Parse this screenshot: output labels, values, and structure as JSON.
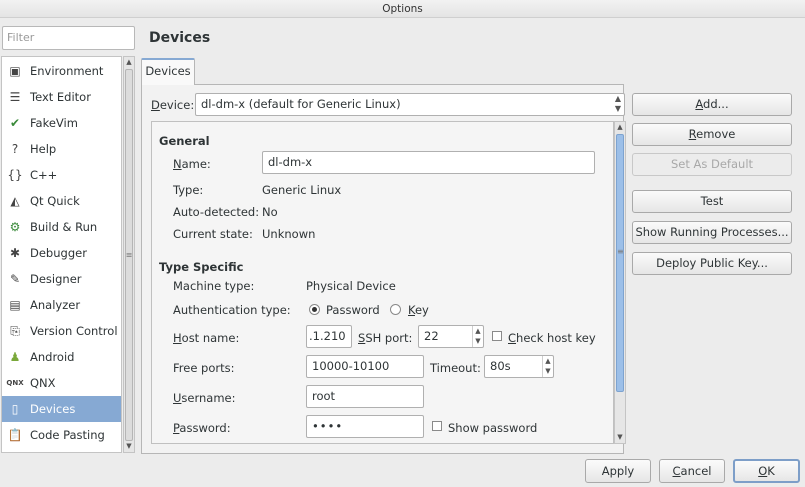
{
  "window": {
    "title": "Options"
  },
  "filter": {
    "placeholder": "Filter"
  },
  "categories": [
    {
      "label": "Environment",
      "icon": "monitor-icon"
    },
    {
      "label": "Text Editor",
      "icon": "text-editor-icon"
    },
    {
      "label": "FakeVim",
      "icon": "fakevim-icon"
    },
    {
      "label": "Help",
      "icon": "help-icon"
    },
    {
      "label": "C++",
      "icon": "cpp-braces-icon"
    },
    {
      "label": "Qt Quick",
      "icon": "qt-quick-icon"
    },
    {
      "label": "Build & Run",
      "icon": "build-run-icon"
    },
    {
      "label": "Debugger",
      "icon": "bug-icon"
    },
    {
      "label": "Designer",
      "icon": "designer-icon"
    },
    {
      "label": "Analyzer",
      "icon": "analyzer-icon"
    },
    {
      "label": "Version Control",
      "icon": "version-control-icon"
    },
    {
      "label": "Android",
      "icon": "android-icon"
    },
    {
      "label": "QNX",
      "icon": "qnx-icon"
    },
    {
      "label": "Devices",
      "icon": "devices-icon"
    },
    {
      "label": "Code Pasting",
      "icon": "code-pasting-icon"
    }
  ],
  "selected_category": "Devices",
  "page": {
    "title": "Devices",
    "tab": "Devices"
  },
  "device": {
    "label": "Device:",
    "value": "dl-dm-x (default for Generic Linux)"
  },
  "general": {
    "header": "General",
    "name_label": "Name:",
    "name_value": "dl-dm-x",
    "type_label": "Type:",
    "type_value": "Generic Linux",
    "auto_label": "Auto-detected:",
    "auto_value": "No",
    "state_label": "Current state:",
    "state_value": "Unknown"
  },
  "specific": {
    "header": "Type Specific",
    "machine_label": "Machine type:",
    "machine_value": "Physical Device",
    "auth_label": "Authentication type:",
    "auth_password": "Password",
    "auth_key": "Key",
    "auth_selected": "Password",
    "host_label": "Host name:",
    "host_value": ".1.210",
    "ssh_label": "SSH port:",
    "ssh_value": "22",
    "check_host_key": "Check host key",
    "ports_label": "Free ports:",
    "ports_value": "10000-10100",
    "timeout_label": "Timeout:",
    "timeout_value": "80s",
    "username_label": "Username:",
    "username_value": "root",
    "password_label": "Password:",
    "password_value": "••••",
    "show_password": "Show password"
  },
  "side_buttons": {
    "add": "Add...",
    "remove": "Remove",
    "set_default": "Set As Default",
    "test": "Test",
    "show_processes": "Show Running Processes...",
    "deploy_key": "Deploy Public Key..."
  },
  "footer": {
    "apply": "Apply",
    "cancel": "Cancel",
    "ok": "OK"
  }
}
